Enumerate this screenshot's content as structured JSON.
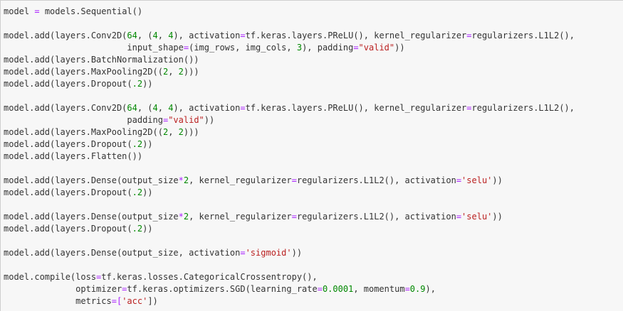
{
  "editor": {
    "lines": [
      [
        {
          "t": "model "
        },
        {
          "t": "=",
          "c": "op"
        },
        {
          "t": " models.Sequential()"
        }
      ],
      [],
      [
        {
          "t": "model.add(layers.Conv2D("
        },
        {
          "t": "64",
          "c": "num"
        },
        {
          "t": ", ("
        },
        {
          "t": "4",
          "c": "num"
        },
        {
          "t": ", "
        },
        {
          "t": "4",
          "c": "num"
        },
        {
          "t": "), activation"
        },
        {
          "t": "=",
          "c": "op"
        },
        {
          "t": "tf.keras.layers.PReLU(), kernel_regularizer"
        },
        {
          "t": "=",
          "c": "op"
        },
        {
          "t": "regularizers.L1L2(),"
        }
      ],
      [
        {
          "t": "                        input_shape"
        },
        {
          "t": "=",
          "c": "op"
        },
        {
          "t": "(img_rows, img_cols, "
        },
        {
          "t": "3",
          "c": "num"
        },
        {
          "t": "), padding"
        },
        {
          "t": "=",
          "c": "op"
        },
        {
          "t": "\"valid\"",
          "c": "str"
        },
        {
          "t": "))"
        }
      ],
      [
        {
          "t": "model.add(layers.BatchNormalization())"
        }
      ],
      [
        {
          "t": "model.add(layers.MaxPooling2D(("
        },
        {
          "t": "2",
          "c": "num"
        },
        {
          "t": ", "
        },
        {
          "t": "2",
          "c": "num"
        },
        {
          "t": ")))"
        }
      ],
      [
        {
          "t": "model.add(layers.Dropout("
        },
        {
          "t": ".2",
          "c": "num"
        },
        {
          "t": "))"
        }
      ],
      [],
      [
        {
          "t": "model.add(layers.Conv2D("
        },
        {
          "t": "64",
          "c": "num"
        },
        {
          "t": ", ("
        },
        {
          "t": "4",
          "c": "num"
        },
        {
          "t": ", "
        },
        {
          "t": "4",
          "c": "num"
        },
        {
          "t": "), activation"
        },
        {
          "t": "=",
          "c": "op"
        },
        {
          "t": "tf.keras.layers.PReLU(), kernel_regularizer"
        },
        {
          "t": "=",
          "c": "op"
        },
        {
          "t": "regularizers.L1L2(),"
        }
      ],
      [
        {
          "t": "                        padding"
        },
        {
          "t": "=",
          "c": "op"
        },
        {
          "t": "\"valid\"",
          "c": "str"
        },
        {
          "t": "))"
        }
      ],
      [
        {
          "t": "model.add(layers.MaxPooling2D(("
        },
        {
          "t": "2",
          "c": "num"
        },
        {
          "t": ", "
        },
        {
          "t": "2",
          "c": "num"
        },
        {
          "t": ")))"
        }
      ],
      [
        {
          "t": "model.add(layers.Dropout("
        },
        {
          "t": ".2",
          "c": "num"
        },
        {
          "t": "))"
        }
      ],
      [
        {
          "t": "model.add(layers.Flatten())"
        }
      ],
      [],
      [
        {
          "t": "model.add(layers.Dense(output_size"
        },
        {
          "t": "*",
          "c": "op"
        },
        {
          "t": "2",
          "c": "num"
        },
        {
          "t": ", kernel_regularizer"
        },
        {
          "t": "=",
          "c": "op"
        },
        {
          "t": "regularizers.L1L2(), activation"
        },
        {
          "t": "=",
          "c": "op"
        },
        {
          "t": "'selu'",
          "c": "str"
        },
        {
          "t": "))"
        }
      ],
      [
        {
          "t": "model.add(layers.Dropout("
        },
        {
          "t": ".2",
          "c": "num"
        },
        {
          "t": "))"
        }
      ],
      [],
      [
        {
          "t": "model.add(layers.Dense(output_size"
        },
        {
          "t": "*",
          "c": "op"
        },
        {
          "t": "2",
          "c": "num"
        },
        {
          "t": ", kernel_regularizer"
        },
        {
          "t": "=",
          "c": "op"
        },
        {
          "t": "regularizers.L1L2(), activation"
        },
        {
          "t": "=",
          "c": "op"
        },
        {
          "t": "'selu'",
          "c": "str"
        },
        {
          "t": "))"
        }
      ],
      [
        {
          "t": "model.add(layers.Dropout("
        },
        {
          "t": ".2",
          "c": "num"
        },
        {
          "t": "))"
        }
      ],
      [],
      [
        {
          "t": "model.add(layers.Dense(output_size, activation"
        },
        {
          "t": "=",
          "c": "op"
        },
        {
          "t": "'sigmoid'",
          "c": "str"
        },
        {
          "t": "))"
        }
      ],
      [],
      [
        {
          "t": "model.compile(loss"
        },
        {
          "t": "=",
          "c": "op"
        },
        {
          "t": "tf.keras.losses.CategoricalCrossentropy(),"
        }
      ],
      [
        {
          "t": "              optimizer"
        },
        {
          "t": "=",
          "c": "op"
        },
        {
          "t": "tf.keras.optimizers.SGD(learning_rate"
        },
        {
          "t": "=",
          "c": "op"
        },
        {
          "t": "0.0001",
          "c": "num"
        },
        {
          "t": ", momentum"
        },
        {
          "t": "=",
          "c": "op"
        },
        {
          "t": "0.9",
          "c": "num"
        },
        {
          "t": "),"
        }
      ],
      [
        {
          "t": "              metrics"
        },
        {
          "t": "=",
          "c": "op"
        },
        {
          "t": "[",
          "c": "op"
        },
        {
          "t": "'acc'",
          "c": "str"
        },
        {
          "t": "])"
        }
      ]
    ]
  }
}
